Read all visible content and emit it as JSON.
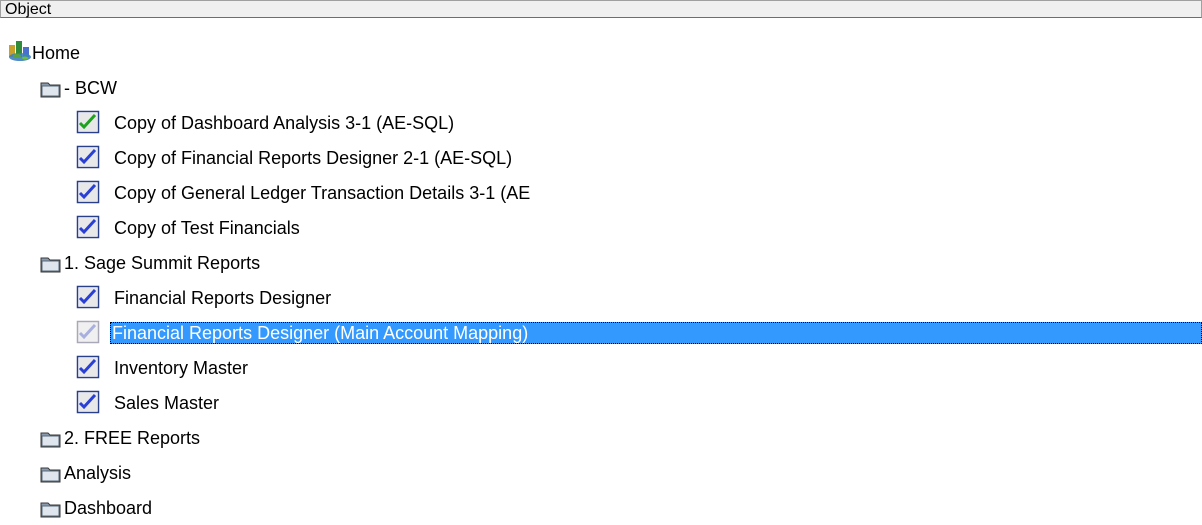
{
  "header": {
    "column_label": "Object"
  },
  "tree": {
    "home": {
      "label": "Home",
      "icon": "home-globe-icon"
    },
    "items": [
      {
        "label": "- BCW",
        "type": "folder",
        "icon": "folder-icon"
      },
      {
        "label": "Copy of Dashboard Analysis 3-1 (AE-SQL)",
        "type": "report",
        "icon": "report-check-green-icon"
      },
      {
        "label": "Copy of Financial Reports Designer 2-1 (AE-SQL)",
        "type": "report",
        "icon": "report-check-blue-icon"
      },
      {
        "label": "Copy of General Ledger Transaction Details 3-1 (AE",
        "type": "report",
        "icon": "report-check-blue-icon"
      },
      {
        "label": "Copy of Test Financials",
        "type": "report",
        "icon": "report-check-blue-icon"
      },
      {
        "label": "1. Sage Summit Reports",
        "type": "folder",
        "icon": "folder-icon"
      },
      {
        "label": "Financial Reports Designer",
        "type": "report",
        "icon": "report-check-blue-icon"
      },
      {
        "label": "Financial Reports Designer (Main Account Mapping)",
        "type": "report",
        "icon": "report-check-faded-icon",
        "selected": true
      },
      {
        "label": "Inventory Master",
        "type": "report",
        "icon": "report-check-blue-icon"
      },
      {
        "label": "Sales Master",
        "type": "report",
        "icon": "report-check-blue-icon"
      },
      {
        "label": "2. FREE Reports",
        "type": "folder",
        "icon": "folder-icon"
      },
      {
        "label": "Analysis",
        "type": "folder",
        "icon": "folder-icon"
      },
      {
        "label": "Dashboard",
        "type": "folder",
        "icon": "folder-icon"
      }
    ]
  },
  "colors": {
    "selection": "#3399ff",
    "selection_text": "#ffffff",
    "header_bg": "#f0f0f0",
    "check_blue": "#2a3fd6",
    "check_green": "#1fa21f"
  }
}
